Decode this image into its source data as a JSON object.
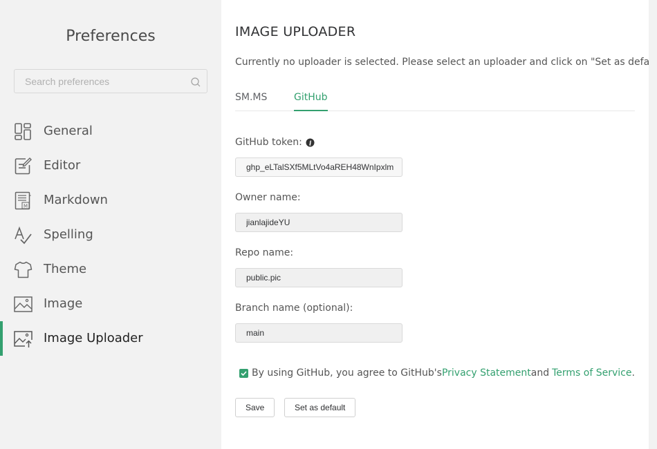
{
  "sidebar": {
    "title": "Preferences",
    "search_placeholder": "Search preferences",
    "items": [
      {
        "label": "General",
        "icon": "general-icon"
      },
      {
        "label": "Editor",
        "icon": "editor-icon"
      },
      {
        "label": "Markdown",
        "icon": "markdown-icon"
      },
      {
        "label": "Spelling",
        "icon": "spelling-icon"
      },
      {
        "label": "Theme",
        "icon": "theme-icon"
      },
      {
        "label": "Image",
        "icon": "image-icon"
      },
      {
        "label": "Image Uploader",
        "icon": "image-uploader-icon",
        "active": true
      }
    ]
  },
  "main": {
    "title": "IMAGE UPLOADER",
    "notice": "Currently no uploader is selected. Please select an uploader and click on \"Set as default\".",
    "tabs": [
      {
        "label": "SM.MS",
        "active": false
      },
      {
        "label": "GitHub",
        "active": true
      }
    ],
    "fields": {
      "token": {
        "label": "GitHub token:",
        "value": "ghp_eLTalSXf5MLtVo4aREH48WnIpxlm"
      },
      "owner": {
        "label": "Owner name:",
        "value": "jianlajideYU"
      },
      "repo": {
        "label": "Repo name:",
        "value": "public.pic"
      },
      "branch": {
        "label": "Branch name (optional):",
        "value": "main"
      }
    },
    "agreement": {
      "checked": true,
      "prefix": "By using GitHub, you agree to GitHub's",
      "privacy_link": "Privacy Statement",
      "and": "and",
      "terms_link": "Terms of Service",
      "suffix": "."
    },
    "buttons": {
      "save": "Save",
      "set_default": "Set as default"
    }
  },
  "colors": {
    "accent": "#33a06f",
    "sidebar_bg": "#f2f2f2",
    "input_bg": "#f0f0f0"
  }
}
